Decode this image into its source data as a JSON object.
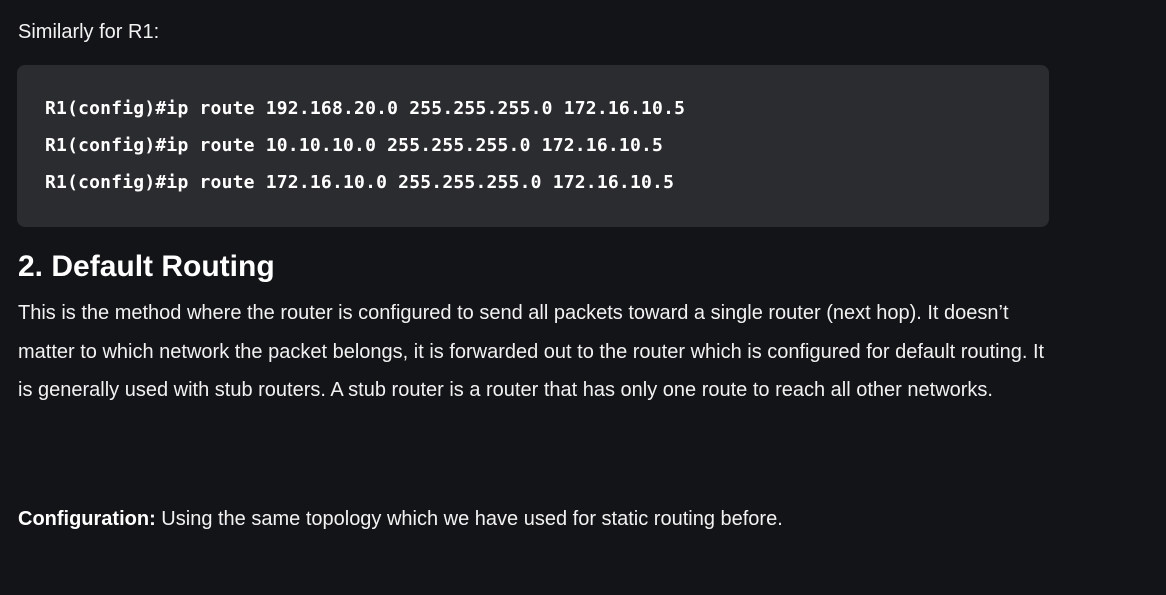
{
  "intro_text": "Similarly for R1:",
  "code_block": {
    "lines": [
      "R1(config)#ip route 192.168.20.0 255.255.255.0 172.16.10.5",
      "R1(config)#ip route 10.10.10.0 255.255.255.0 172.16.10.5",
      "R1(config)#ip route 172.16.10.0 255.255.255.0 172.16.10.5"
    ]
  },
  "section": {
    "heading": "2. Default Routing",
    "paragraph": "This is the method where the router is configured to send all packets toward a single router (next hop). It doesn’t matter to which network the packet belongs, it is forwarded out to the router which is configured for default routing. It is generally used with stub routers. A stub router is a router that has only one route to reach all other networks.",
    "config_label": "Configuration:",
    "config_text": " Using the same topology which we have used for static routing before."
  },
  "colors": {
    "background": "#131417",
    "code_background": "#2b2c30",
    "text": "#f2f2f2"
  }
}
